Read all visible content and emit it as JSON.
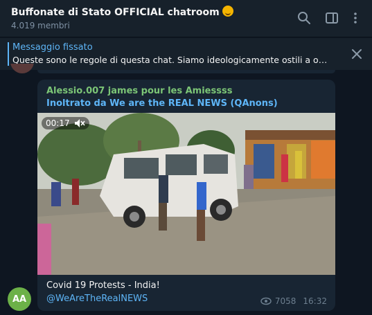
{
  "header": {
    "title": "Buffonate di Stato OFFICIAL chatroom",
    "title_emoji": "face-with-hand-over-mouth-emoji",
    "members": "4.019 membri",
    "icons": [
      "search-icon",
      "sidebar-toggle-icon",
      "more-vertical-icon"
    ]
  },
  "pinned": {
    "title": "Messaggio fissato",
    "text": "Queste sono le regole di questa chat.  Siamo ideologicamente ostili a ogni fo..."
  },
  "message": {
    "author": "Alessio.007 james pour les Amiessss",
    "forwarded_from": "Inoltrato da We are the REAL NEWS (QAnons)",
    "video": {
      "duration": "00:17",
      "muted_icon": "speaker-muted-icon"
    },
    "caption": "Covid 19 Protests - India!",
    "mention": "@WeAreTheRealNEWS",
    "views": "7058",
    "time": "16:32",
    "avatar_initials": "AA"
  },
  "colors": {
    "background": "#0e1621",
    "panel": "#17212b",
    "bubble": "#182533",
    "accent": "#5eb5f7",
    "author": "#7cc576",
    "avatar": "#6cb148"
  }
}
